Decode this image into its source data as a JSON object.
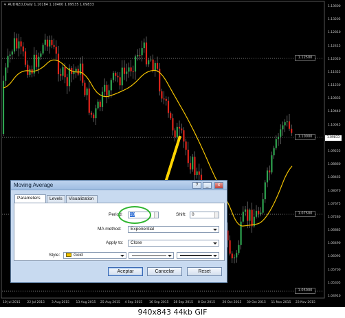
{
  "chart": {
    "symbol_label": "AUDNZD,Daily  1.10184 1.10400 1.09535 1.09833",
    "price_labels": [
      "1.13600",
      "1.13205",
      "1.12810",
      "1.12415",
      "1.12020",
      "1.11625",
      "1.11230",
      "1.10835",
      "1.10440",
      "1.10045",
      "1.09650",
      "1.09255",
      "1.08860",
      "1.08465",
      "1.08070",
      "1.07675",
      "1.07280",
      "1.06885",
      "1.06490",
      "1.06095",
      "1.05700",
      "1.05305",
      "1.04910"
    ],
    "level_boxes": [
      "1.12500",
      "1.10000",
      "1.07500",
      "1.05000"
    ],
    "current_price": "1.09833",
    "dates": [
      "10 Jul 2015",
      "22 Jul 2015",
      "3 Aug 2015",
      "13 Aug 2015",
      "25 Aug 2015",
      "4 Sep 2015",
      "16 Sep 2015",
      "28 Sep 2015",
      "8 Oct 2015",
      "20 Oct 2015",
      "30 Oct 2015",
      "11 Nov 2015",
      "23 Nov 2015"
    ],
    "colors": {
      "bull": "#2ea44f",
      "bear": "#e0241b",
      "ma": "#f2c200",
      "annotation_arrow": "#ffd400",
      "annotation_ellipse": "#2fb52f"
    }
  },
  "dialog": {
    "title": "Moving Average",
    "title_buttons": [
      "?",
      "_",
      "x"
    ],
    "tabs": [
      "Parameters",
      "Levels",
      "Visualization"
    ],
    "period_label": "Period:",
    "period_value": "10",
    "shift_label": "Shift:",
    "shift_value": "0",
    "ma_method_label": "MA method:",
    "ma_method_value": "Exponential",
    "apply_to_label": "Apply to:",
    "apply_to_value": "Close",
    "style_label": "Style:",
    "style_color_name": "Gold",
    "buttons": {
      "accept": "Aceptar",
      "cancel": "Cancelar",
      "reset": "Reset"
    }
  },
  "caption": "940x843  44kb  GIF"
}
